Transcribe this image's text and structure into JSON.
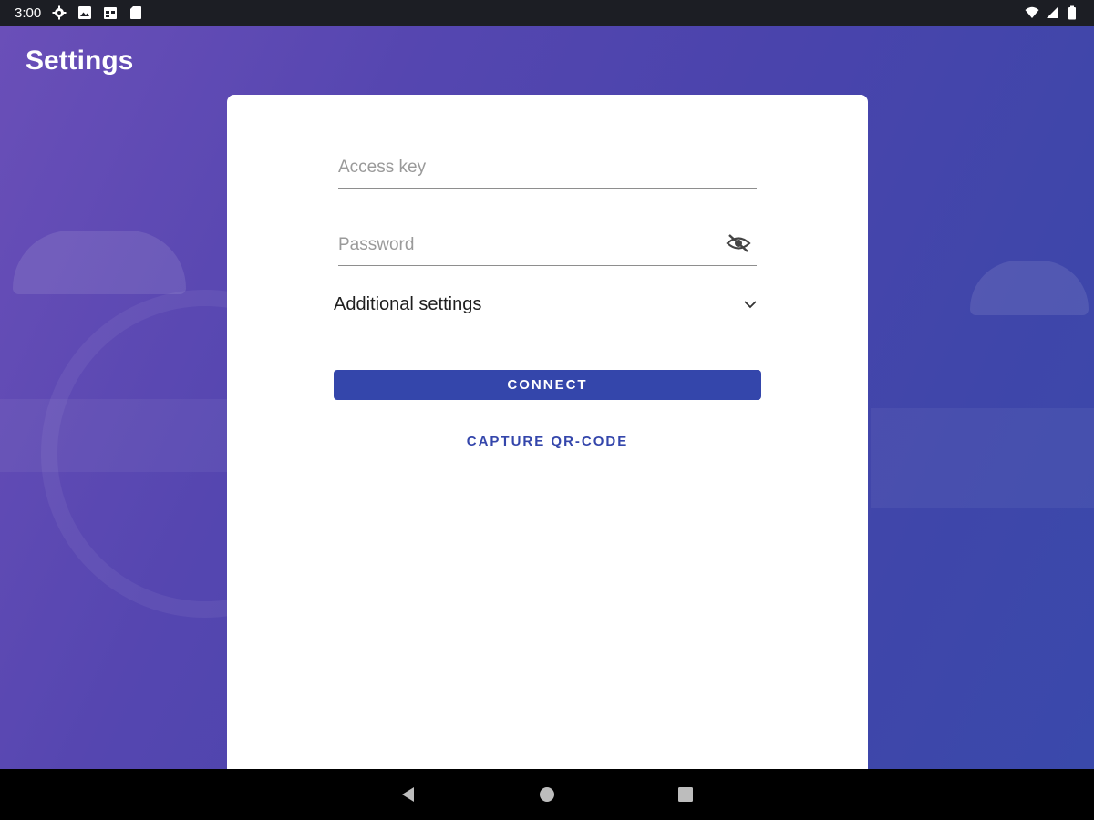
{
  "status_bar": {
    "time": "3:00",
    "left_icons": [
      "settings-icon",
      "image-icon",
      "calendar-icon",
      "sd-card-icon"
    ],
    "right_icons": [
      "wifi-icon",
      "signal-icon",
      "battery-icon"
    ]
  },
  "header": {
    "title": "Settings"
  },
  "form": {
    "access_key_placeholder": "Access key",
    "access_key_value": "",
    "password_placeholder": "Password",
    "password_value": "",
    "password_toggle_icon": "eye-off-icon",
    "additional_settings_label": "Additional settings",
    "additional_settings_icon": "chevron-down-icon",
    "connect_label": "CONNECT",
    "capture_qr_label": "CAPTURE QR-CODE"
  },
  "colors": {
    "accent": "#3446ab",
    "background_gradient": [
      "#6a4fb8",
      "#3a49ab"
    ],
    "status_bar": "#1c1e24",
    "nav_bar": "#000000"
  },
  "nav_bar": {
    "buttons": [
      "back-icon",
      "home-icon",
      "recents-icon"
    ]
  }
}
